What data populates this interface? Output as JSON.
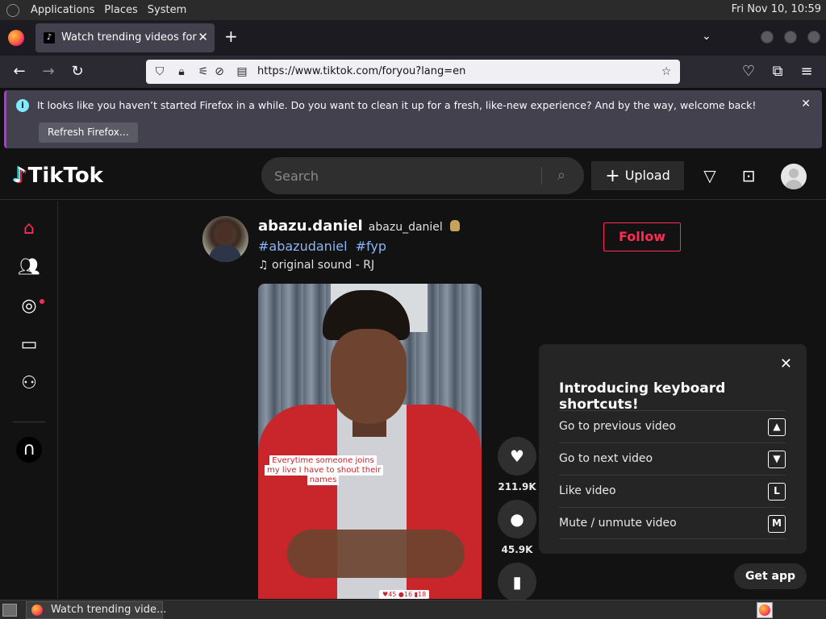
{
  "desktop_panel": {
    "menus": [
      "Applications",
      "Places",
      "System"
    ],
    "clock": "Fri Nov 10, 10:59"
  },
  "browser": {
    "tab": {
      "title": "Watch trending videos for y",
      "favicon": "tiktok-logo-icon"
    },
    "url": "https://www.tiktok.com/foryou?lang=en",
    "notification": {
      "message": "It looks like you haven’t started Firefox in a while. Do you want to clean it up for a fresh, like-new experience? And by the way, welcome back!",
      "button_label": "Refresh Firefox…"
    }
  },
  "tiktok": {
    "logo_text": "TikTok",
    "search": {
      "placeholder": "Search"
    },
    "upload_label": "Upload",
    "post": {
      "username": "abazu.daniel",
      "nickname": "abazu_daniel",
      "hashtags": [
        "#abazudaniel",
        "#fyp"
      ],
      "sound": "original sound - RJ",
      "follow_label": "Follow",
      "video_overlay_text": "Everytime someone joins my live I have to shout their names",
      "video_stats_text": "♥45 ●16 ▮18",
      "likes": "211.9K",
      "comments": "45.9K"
    },
    "shortcuts_popup": {
      "title": "Introducing keyboard shortcuts!",
      "items": [
        {
          "label": "Go to previous video",
          "key": "▲"
        },
        {
          "label": "Go to next video",
          "key": "▼"
        },
        {
          "label": "Like video",
          "key": "L"
        },
        {
          "label": "Mute / unmute video",
          "key": "M"
        }
      ]
    },
    "get_app_label": "Get app"
  },
  "taskbar": {
    "task_label": "Watch trending vide..."
  },
  "colors": {
    "tiktok_red": "#fe2c55",
    "page_bg": "#121212",
    "hashtag_blue": "#8ab4f8"
  }
}
